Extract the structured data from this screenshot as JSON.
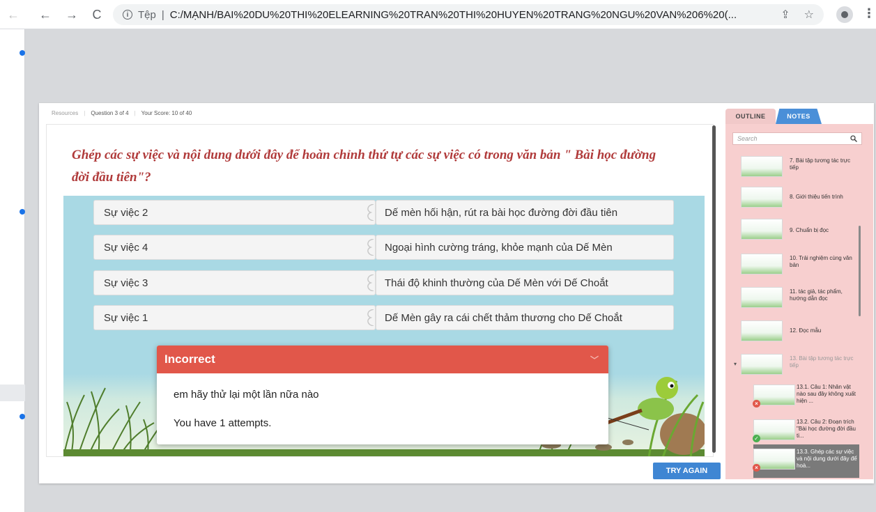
{
  "browser": {
    "protocol": "Tệp",
    "url": "C:/MẠNH/BAI%20DU%20THI%20ELEARNING%20TRAN%20THI%20HUYEN%20TRANG%20NGU%20VAN%206%20(..."
  },
  "crumbs": {
    "resources": "Resources",
    "question": "Question 3 of 4",
    "score": "Your Score: 10 of 40"
  },
  "question_text": "Ghép các sự việc và nội dung dưới đây để hoàn chỉnh thứ tự các sự việc có trong văn bản \" Bài học đường đời đầu tiên\"?",
  "pairs": [
    {
      "left": "Sự việc 2",
      "right": "Dế mèn hối hận, rút ra bài học đường đời đầu tiên"
    },
    {
      "left": "Sự việc 4",
      "right": "Ngoại hình cường tráng, khỏe mạnh của Dế Mèn"
    },
    {
      "left": "Sự việc 3",
      "right": "Thái độ khinh thường của Dế Mèn với Dế Choắt"
    },
    {
      "left": "Sự việc 1",
      "right": "Dế Mèn gây ra cái chết thảm thương cho Dế Choắt"
    }
  ],
  "feedback": {
    "title": "Incorrect",
    "message": "em hãy thử lại một lần nữa nào",
    "attempts": "You have 1 attempts."
  },
  "try_again": "TRY AGAIN",
  "sidebar": {
    "tab_outline": "OUTLINE",
    "tab_notes": "NOTES",
    "search_placeholder": "Search",
    "items": [
      {
        "label": "7. Bài tập tương tác trực tiếp"
      },
      {
        "label": "8. Giới thiệu tiến trình"
      },
      {
        "label": "9. Chuẩn bị đọc"
      },
      {
        "label": "10. Trải nghiệm cùng văn bản"
      },
      {
        "label": "11. tác giả, tác phẩm, hướng dẫn đọc"
      },
      {
        "label": "12. Đọc mẫu"
      },
      {
        "label": "13. Bài tập tương tác trực tiếp"
      }
    ],
    "subitems": [
      {
        "label": "13.1. Câu 1: Nhân vật nào sau đây không xuất hiện ...",
        "status": "incorrect"
      },
      {
        "label": "13.2. Câu 2: Đoạn trích \"Bài học đường đời đầu ti...",
        "status": "correct"
      },
      {
        "label": "13.3. Ghép các sự việc và nội dung dưới đây để hoà...",
        "status": "incorrect"
      }
    ]
  },
  "colors": {
    "incorrect_header": "#e1574a",
    "question_text": "#b03a3a",
    "stage_bg": "#a9d9e4",
    "try_again": "#3f86d3",
    "sidebar_bg": "#f7cfcf"
  }
}
